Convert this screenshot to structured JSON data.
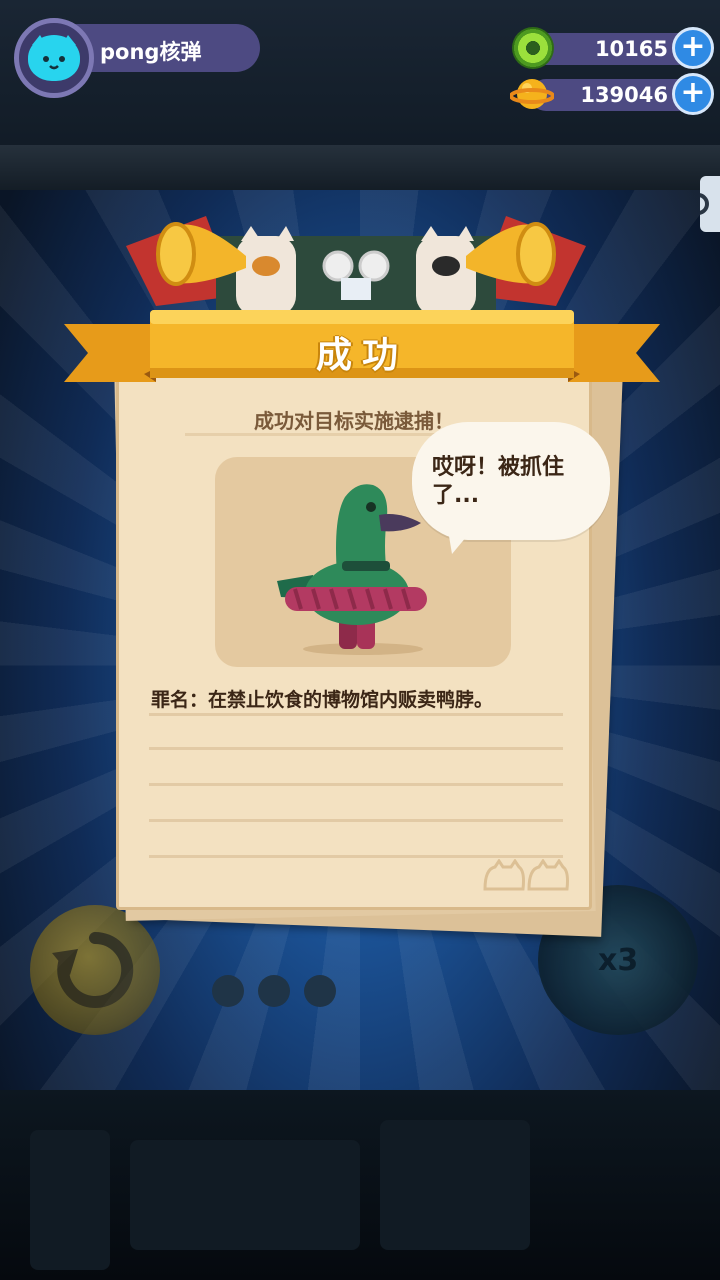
{
  "player": {
    "name": "pong核弹"
  },
  "currencies": [
    {
      "icon": "green-donut-coin-icon",
      "value": "10165"
    },
    {
      "icon": "gold-planet-coin-icon",
      "value": "139046"
    }
  ],
  "popup": {
    "title": "成功",
    "subtitle": "成功对目标实施逮捕！",
    "speech": "哎呀！被抓住了...",
    "crime": "罪名：在禁止饮食的博物馆内贩卖鸭脖。"
  },
  "background_ui": {
    "speed_label": "x3"
  },
  "colors": {
    "banner": "#f5b62a",
    "paper": "#f3e1c1",
    "hud_pill": "#4d4a82",
    "plus_button": "#2f8ae4"
  }
}
